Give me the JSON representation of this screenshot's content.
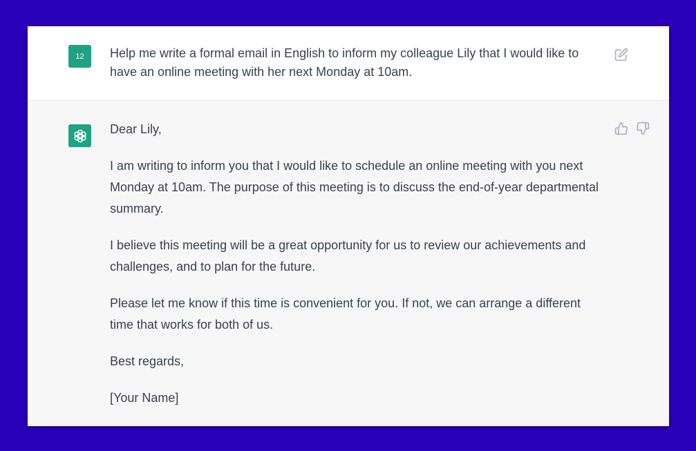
{
  "colors": {
    "background": "#2a00b8",
    "avatar_green": "#1fa383",
    "assistant_bg": "#f7f7f8",
    "text": "#374151",
    "icon_gray": "#acacbe"
  },
  "user_message": {
    "avatar_label": "12",
    "text": "Help me write a formal email in English to inform my colleague Lily that I would like to have an online meeting with her next Monday at 10am.",
    "edit_icon": "edit-icon"
  },
  "assistant_message": {
    "avatar_icon": "openai-logo-icon",
    "paragraphs": [
      "Dear Lily,",
      "I am writing to inform you that I would like to schedule an online meeting with you next Monday at 10am. The purpose of this meeting is to discuss the end-of-year departmental summary.",
      "I believe this meeting will be a great opportunity for us to review our achievements and challenges, and to plan for the future.",
      "Please let me know if this time is convenient for you. If not, we can arrange a different time that works for both of us.",
      "Best regards,",
      "[Your Name]"
    ],
    "feedback_icons": [
      "thumbs-up-icon",
      "thumbs-down-icon"
    ]
  }
}
